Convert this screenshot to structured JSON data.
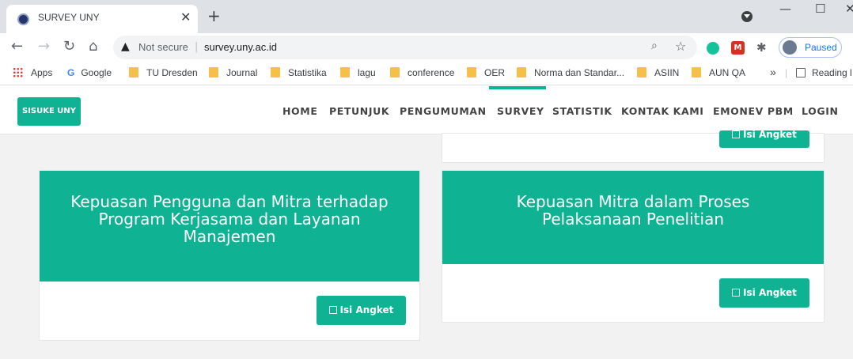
{
  "browser": {
    "tab_title": "SURVEY UNY",
    "tab_close": "✕",
    "new_tab": "+",
    "window_minimize": "—",
    "window_maximize": "☐",
    "window_close": "✕",
    "security_label": "Not secure",
    "url": "survey.uny.ac.id",
    "profile_label": "Paused",
    "ext_m_label": "M"
  },
  "bookmarks": {
    "items": [
      "Apps",
      "Google",
      "TU Dresden",
      "Journal",
      "Statistika",
      "lagu",
      "conference",
      "OER",
      "Norma dan Standar...",
      "ASIIN",
      "AUN QA"
    ],
    "overflow": "»",
    "reading_list": "Reading l"
  },
  "site": {
    "brand": "SISUKE UNY",
    "nav": [
      "HOME",
      "PETUNJUK",
      "PENGUMUMAN",
      "SURVEY",
      "STATISTIK",
      "KONTAK KAMI",
      "EMONEV PBM",
      "LOGIN"
    ],
    "active_nav": "SURVEY",
    "accent_color": "#0fb394"
  },
  "cards": [
    {
      "title": "Kepuasan Pengguna dan Mitra terhadap Program Kerjasama dan Layanan Manajemen",
      "button": "Isi Angket"
    },
    {
      "title": "Kepuasan Mitra dalam Proses Pelaksanaan Penelitian",
      "button": "Isi Angket"
    }
  ],
  "partial_card_button": "Isi Angket"
}
